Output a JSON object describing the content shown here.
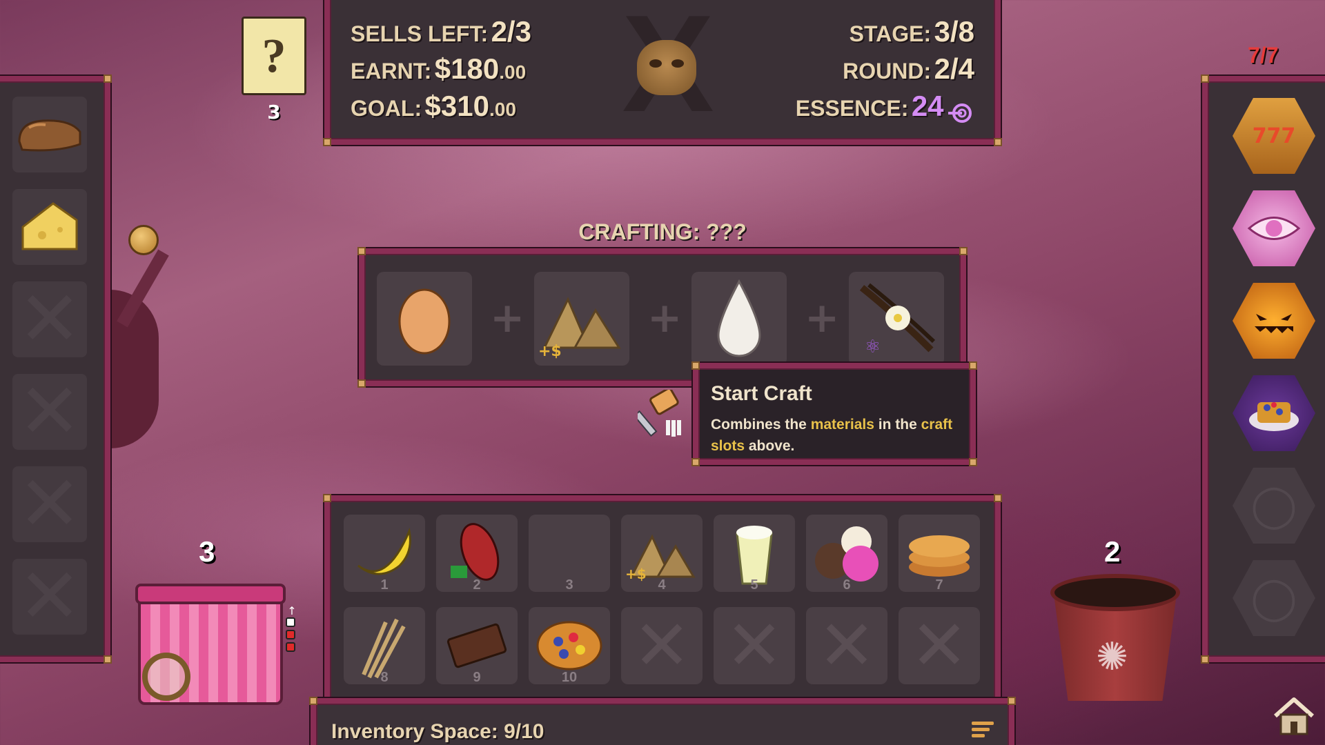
{
  "hud": {
    "sells_left_label": "SELLS LEFT:",
    "sells_left_value": "2/3",
    "earnt_label": "EARNT:",
    "earnt_value": "$180",
    "earnt_cents": ".00",
    "goal_label": "GOAL:",
    "goal_value": "$310",
    "goal_cents": ".00",
    "stage_label": "STAGE:",
    "stage_value": "3/8",
    "round_label": "ROUND:",
    "round_value": "2/4",
    "essence_label": "ESSENCE:",
    "essence_value": "24"
  },
  "note": {
    "symbol": "?",
    "count": "3"
  },
  "relics": {
    "count": "7/7"
  },
  "left_panel": {
    "items": [
      {
        "name": "bread",
        "icon": "bread-icon"
      },
      {
        "name": "cheese",
        "icon": "cheese-icon"
      }
    ],
    "locked_slots": 4
  },
  "right_panel": {
    "items": [
      {
        "name": "slot-machine",
        "icon": "slot-777-icon",
        "label": "777"
      },
      {
        "name": "eye",
        "icon": "eye-icon"
      },
      {
        "name": "jack-o-lantern",
        "icon": "pumpkin-icon"
      },
      {
        "name": "waffle",
        "icon": "waffle-icon"
      }
    ],
    "empty_slots": 2
  },
  "crafting": {
    "title": "CRAFTING: ???",
    "slots": [
      {
        "icon": "egg-icon"
      },
      {
        "icon": "sugar-pile-icon",
        "badge": "+$"
      },
      {
        "icon": "milk-drop-icon"
      },
      {
        "icon": "vanilla-icon",
        "badge": "atom"
      }
    ]
  },
  "tooltip": {
    "title": "Start Craft",
    "body_1": "Combines the ",
    "body_hl1": "materials",
    "body_2": " in the ",
    "body_hl2": "craft slots",
    "body_3": " above."
  },
  "inventory": {
    "slots": [
      {
        "num": "1",
        "icon": "banana-icon"
      },
      {
        "num": "2",
        "icon": "cacao-pod-icon"
      },
      {
        "num": "3",
        "icon": ""
      },
      {
        "num": "4",
        "icon": "sugar-pile-icon",
        "badge": "+$"
      },
      {
        "num": "5",
        "icon": "milkshake-icon"
      },
      {
        "num": "6",
        "icon": "ice-cream-icon"
      },
      {
        "num": "7",
        "icon": "pancakes-icon"
      },
      {
        "num": "8",
        "icon": "wheat-icon"
      },
      {
        "num": "9",
        "icon": "chocolate-bar-icon"
      },
      {
        "num": "10",
        "icon": "fruit-tart-icon"
      }
    ],
    "locked_slots": 4,
    "space_text": "Inventory Space: 9/10"
  },
  "basket": {
    "count": "3",
    "pips": [
      "#ffffff",
      "#e02a2a",
      "#e02a2a"
    ]
  },
  "bucket": {
    "count": "2"
  },
  "colors": {
    "frame": "#8a2e55",
    "essence": "#d48cf4",
    "highlight": "#e9c24a",
    "relic_count": "#e63b3b"
  }
}
